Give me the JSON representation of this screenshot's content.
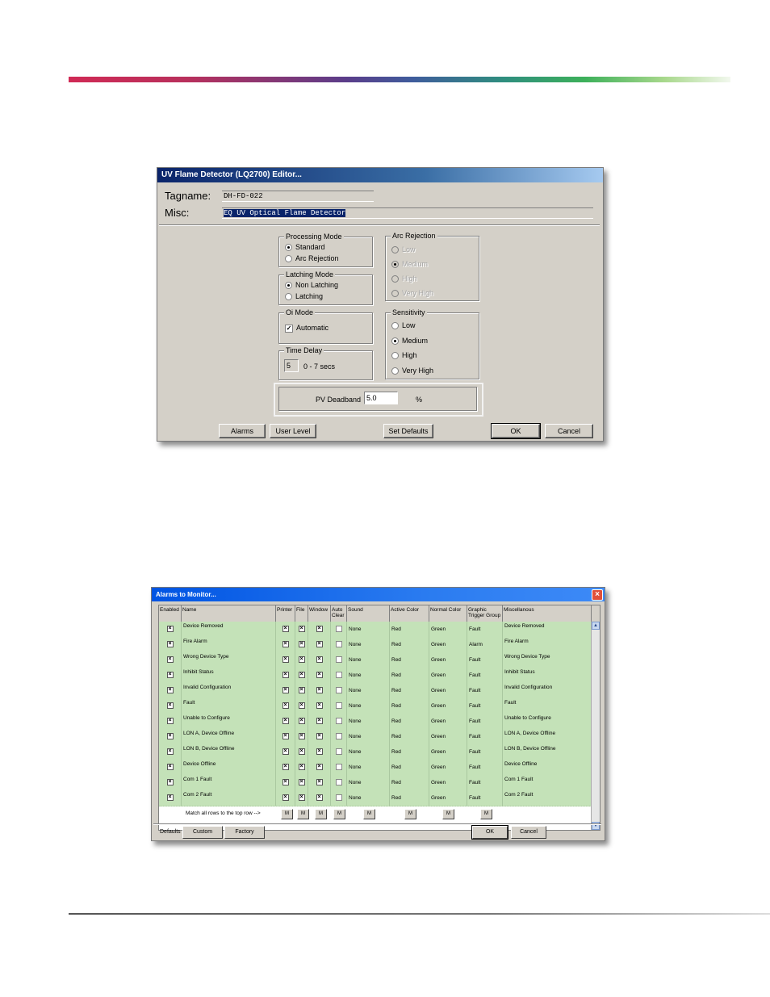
{
  "editor": {
    "title": "UV Flame Detector (LQ2700) Editor...",
    "tagname_label": "Tagname:",
    "tagname_value": "DH-FD-022",
    "misc_label": "Misc:",
    "misc_value": "EQ UV Optical Flame Detector",
    "processing_mode": {
      "title": "Processing Mode",
      "options": [
        "Standard",
        "Arc Rejection"
      ],
      "selected": "Standard"
    },
    "latching_mode": {
      "title": "Latching Mode",
      "options": [
        "Non Latching",
        "Latching"
      ],
      "selected": "Non Latching"
    },
    "oi_mode": {
      "title": "Oi Mode",
      "checkbox_label": "Automatic",
      "checked": true
    },
    "time_delay": {
      "title": "Time Delay",
      "value": "5",
      "range": "0 - 7 secs"
    },
    "arc_rejection": {
      "title": "Arc Rejection",
      "options": [
        "Low",
        "Medium",
        "High",
        "Very High"
      ],
      "selected": "Medium",
      "enabled": false
    },
    "sensitivity": {
      "title": "Sensitivity",
      "options": [
        "Low",
        "Medium",
        "High",
        "Very High"
      ],
      "selected": "Medium"
    },
    "pv_deadband": {
      "label": "PV Deadband",
      "value": "5.0",
      "unit": "%"
    },
    "buttons": {
      "alarms": "Alarms",
      "user_level": "User Level",
      "set_defaults": "Set Defaults",
      "ok": "OK",
      "cancel": "Cancel"
    }
  },
  "alarms": {
    "title": "Alarms to Monitor...",
    "columns": [
      "Enabled",
      "Name",
      "Printer",
      "File",
      "Window",
      "Auto Clear",
      "Sound",
      "Active Color",
      "Normal Color",
      "Graphic Trigger Group",
      "Miscellanous"
    ],
    "rows": [
      {
        "name": "Device Removed",
        "sound": "None",
        "active": "Red",
        "normal": "Green",
        "group": "Fault",
        "misc": "Device Removed"
      },
      {
        "name": "Fire Alarm",
        "sound": "None",
        "active": "Red",
        "normal": "Green",
        "group": "Alarm",
        "misc": "Fire Alarm"
      },
      {
        "name": "Wrong Device Type",
        "sound": "None",
        "active": "Red",
        "normal": "Green",
        "group": "Fault",
        "misc": "Wrong Device Type"
      },
      {
        "name": "Inhibit Status",
        "sound": "None",
        "active": "Red",
        "normal": "Green",
        "group": "Fault",
        "misc": "Inhibit Status"
      },
      {
        "name": "Invalid Configuration",
        "sound": "None",
        "active": "Red",
        "normal": "Green",
        "group": "Fault",
        "misc": "Invalid Configuration"
      },
      {
        "name": "Fault",
        "sound": "None",
        "active": "Red",
        "normal": "Green",
        "group": "Fault",
        "misc": "Fault"
      },
      {
        "name": "Unable to Configure",
        "sound": "None",
        "active": "Red",
        "normal": "Green",
        "group": "Fault",
        "misc": "Unable to Configure"
      },
      {
        "name": "LON A, Device Offline",
        "sound": "None",
        "active": "Red",
        "normal": "Green",
        "group": "Fault",
        "misc": "LON A, Device Offline"
      },
      {
        "name": "LON B, Device Offline",
        "sound": "None",
        "active": "Red",
        "normal": "Green",
        "group": "Fault",
        "misc": "LON B, Device Offline"
      },
      {
        "name": "Device Offline",
        "sound": "None",
        "active": "Red",
        "normal": "Green",
        "group": "Fault",
        "misc": "Device Offline"
      },
      {
        "name": "Com 1 Fault",
        "sound": "None",
        "active": "Red",
        "normal": "Green",
        "group": "Fault",
        "misc": "Com 1 Fault"
      },
      {
        "name": "Com 2 Fault",
        "sound": "None",
        "active": "Red",
        "normal": "Green",
        "group": "Fault",
        "misc": "Com 2 Fault"
      }
    ],
    "match_label": "Match all rows to the top row -->",
    "match_button": "M",
    "defaults_label": "Defaults",
    "buttons": {
      "custom": "Custom",
      "factory": "Factory",
      "ok": "OK",
      "cancel": "Cancel"
    },
    "close_icon": "×"
  },
  "colors": {
    "grid_row": "#c4e2b8",
    "title_bar": "#0a246a",
    "dialog_bg": "#d4d0c8"
  }
}
